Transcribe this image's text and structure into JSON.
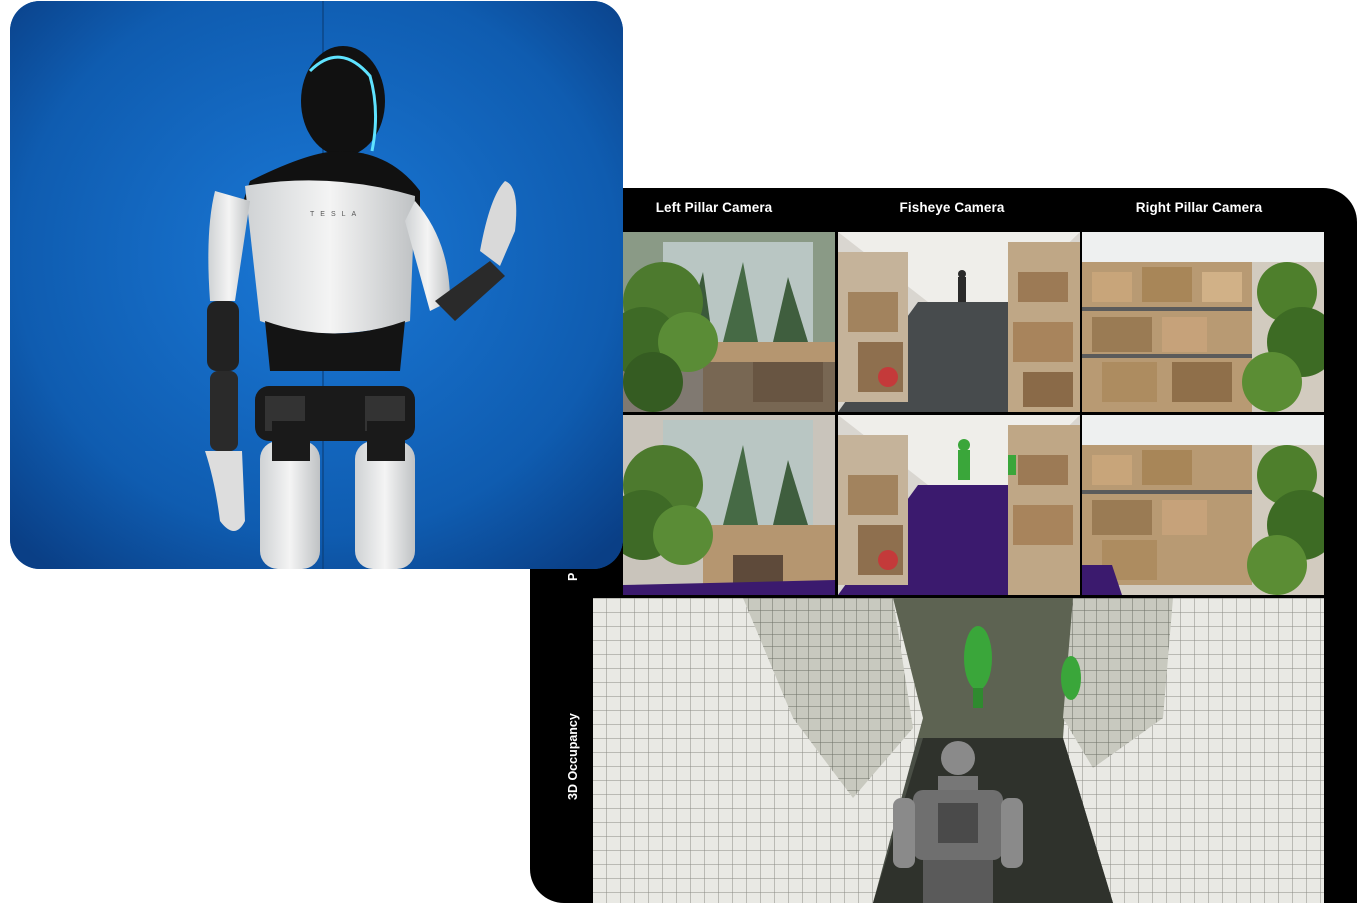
{
  "cameras": {
    "left_pillar": "Left Pillar Camera",
    "fisheye": "Fisheye Camera",
    "right_pillar": "Right Pillar Camera"
  },
  "rows": {
    "occupancy": "3D Occupancy",
    "partial_label": "P"
  },
  "robot": {
    "chest_logo": "TESLA"
  },
  "colors": {
    "card_background": "#1565c0",
    "dashboard_background": "#000000",
    "segmentation_floor": "#3b1a6e",
    "person_highlight": "#3aa63a",
    "robot_accent": "#5fe3ff"
  }
}
